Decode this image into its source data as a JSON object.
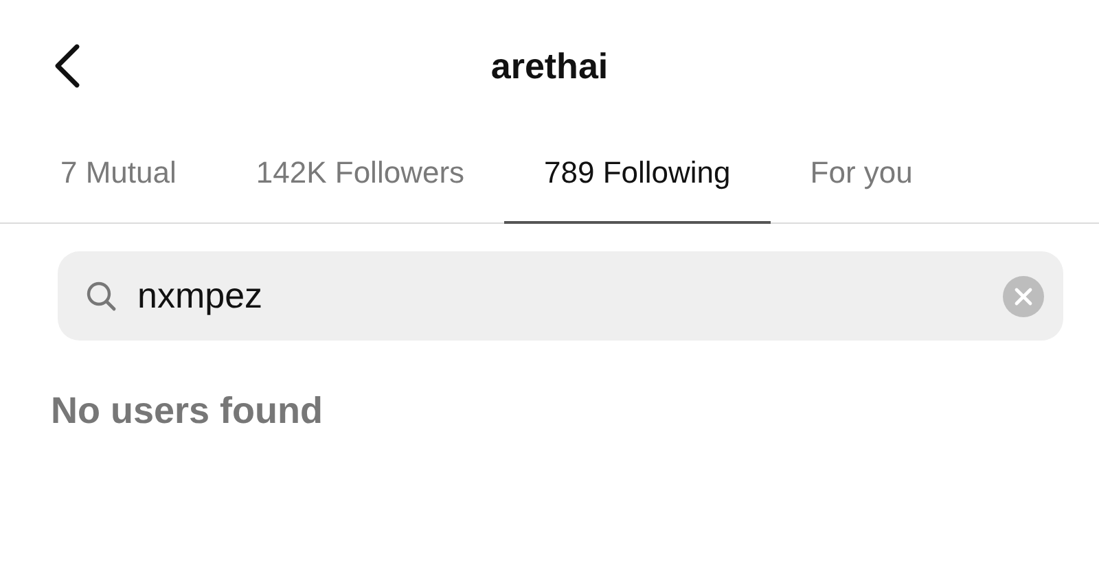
{
  "header": {
    "title": "arethai"
  },
  "tabs": [
    {
      "label": "7 Mutual",
      "selected": false
    },
    {
      "label": "142K Followers",
      "selected": false
    },
    {
      "label": "789 Following",
      "selected": true
    },
    {
      "label": "For you",
      "selected": false
    }
  ],
  "search": {
    "value": "nxmpez"
  },
  "empty_message": "No users found"
}
